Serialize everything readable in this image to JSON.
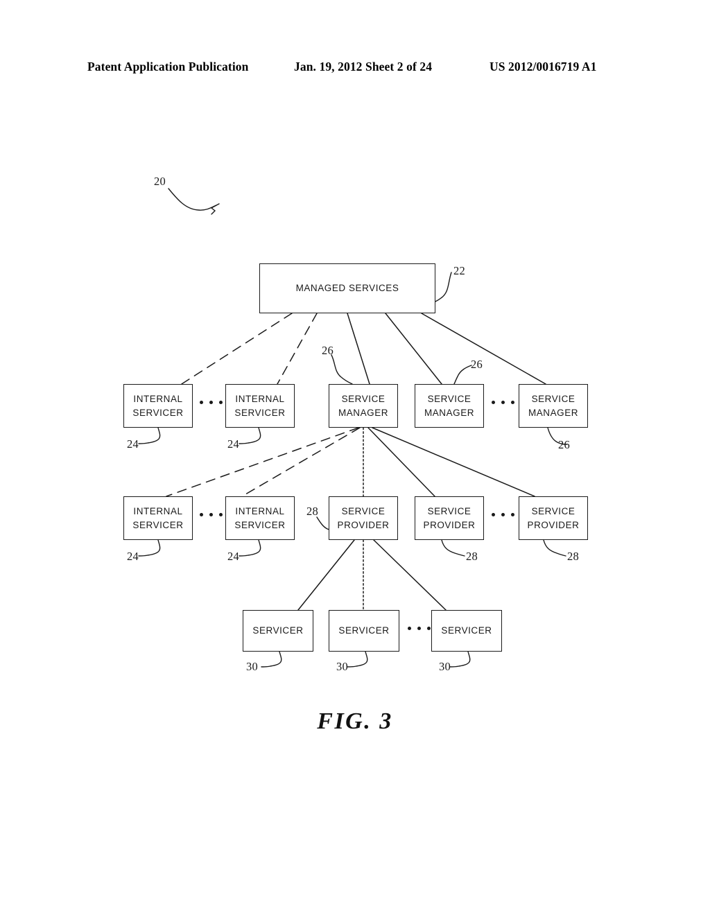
{
  "header": {
    "left": "Patent Application Publication",
    "middle": "Jan. 19, 2012  Sheet 2 of 24",
    "right": "US 2012/0016719 A1"
  },
  "figure": {
    "caption": "FIG. 3",
    "system_ref": "20"
  },
  "nodes": {
    "managed_services": {
      "label": "MANAGED SERVICES",
      "ref": "22"
    },
    "internal_servicer_r1_left": {
      "line1": "INTERNAL",
      "line2": "SERVICER",
      "ref": "24"
    },
    "internal_servicer_r1_right": {
      "line1": "INTERNAL",
      "line2": "SERVICER",
      "ref": "24"
    },
    "service_manager_1": {
      "line1": "SERVICE",
      "line2": "MANAGER",
      "ref": "26"
    },
    "service_manager_2": {
      "line1": "SERVICE",
      "line2": "MANAGER",
      "ref": "26"
    },
    "service_manager_3": {
      "line1": "SERVICE",
      "line2": "MANAGER",
      "ref": "26"
    },
    "internal_servicer_r2_left": {
      "line1": "INTERNAL",
      "line2": "SERVICER",
      "ref": "24"
    },
    "internal_servicer_r2_right": {
      "line1": "INTERNAL",
      "line2": "SERVICER",
      "ref": "24"
    },
    "service_provider_1": {
      "line1": "SERVICE",
      "line2": "PROVIDER",
      "ref": "28"
    },
    "service_provider_2": {
      "line1": "SERVICE",
      "line2": "PROVIDER",
      "ref": "28"
    },
    "service_provider_3": {
      "line1": "SERVICE",
      "line2": "PROVIDER",
      "ref": "28"
    },
    "servicer_1": {
      "label": "SERVICER",
      "ref": "30"
    },
    "servicer_2": {
      "label": "SERVICER",
      "ref": "30"
    },
    "servicer_3": {
      "label": "SERVICER",
      "ref": "30"
    }
  },
  "ellipsis_symbol": "• • •",
  "colors": {
    "ink": "#1a1a1a",
    "background": "#ffffff"
  }
}
